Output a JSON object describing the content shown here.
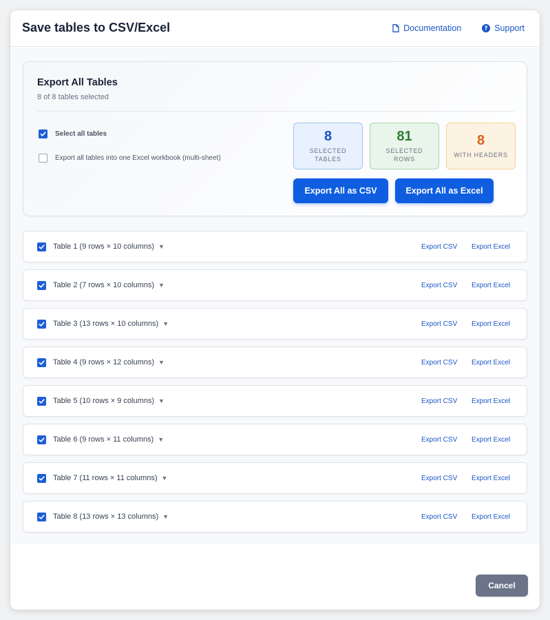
{
  "dialog": {
    "title": "Save tables to CSV/Excel",
    "links": {
      "documentation": "Documentation",
      "support": "Support"
    }
  },
  "summary": {
    "title": "Export All Tables",
    "subtitle": "8 of 8 tables selected",
    "select_all_label": "Select all tables",
    "select_all_checked": true,
    "multi_sheet_label": "Export all tables into one Excel workbook (multi-sheet)",
    "multi_sheet_checked": false,
    "stats": [
      {
        "value": "8",
        "label_line1": "Selected",
        "label_line2": "Tables"
      },
      {
        "value": "81",
        "label_line1": "Selected",
        "label_line2": "Rows"
      },
      {
        "value": "8",
        "label_line1": "With Headers",
        "label_line2": ""
      }
    ],
    "export_csv_label": "Export All as CSV",
    "export_excel_label": "Export All as Excel"
  },
  "tables": [
    {
      "label": "Table 1 (9 rows × 10 columns)",
      "checked": true
    },
    {
      "label": "Table 2 (7 rows × 10 columns)",
      "checked": true
    },
    {
      "label": "Table 3 (13 rows × 10 columns)",
      "checked": true
    },
    {
      "label": "Table 4 (9 rows × 12 columns)",
      "checked": true
    },
    {
      "label": "Table 5 (10 rows × 9 columns)",
      "checked": true
    },
    {
      "label": "Table 6 (9 rows × 11 columns)",
      "checked": true
    },
    {
      "label": "Table 7 (11 rows × 11 columns)",
      "checked": true
    },
    {
      "label": "Table 8 (13 rows × 13 columns)",
      "checked": true
    }
  ],
  "row_actions": {
    "csv": "Export CSV",
    "excel": "Export Excel"
  },
  "caret_glyph": "▼",
  "footer": {
    "cancel_label": "Cancel"
  },
  "colors": {
    "primary": "#0f5ee0",
    "link": "#1a56c4",
    "cancel": "#6b7488"
  }
}
